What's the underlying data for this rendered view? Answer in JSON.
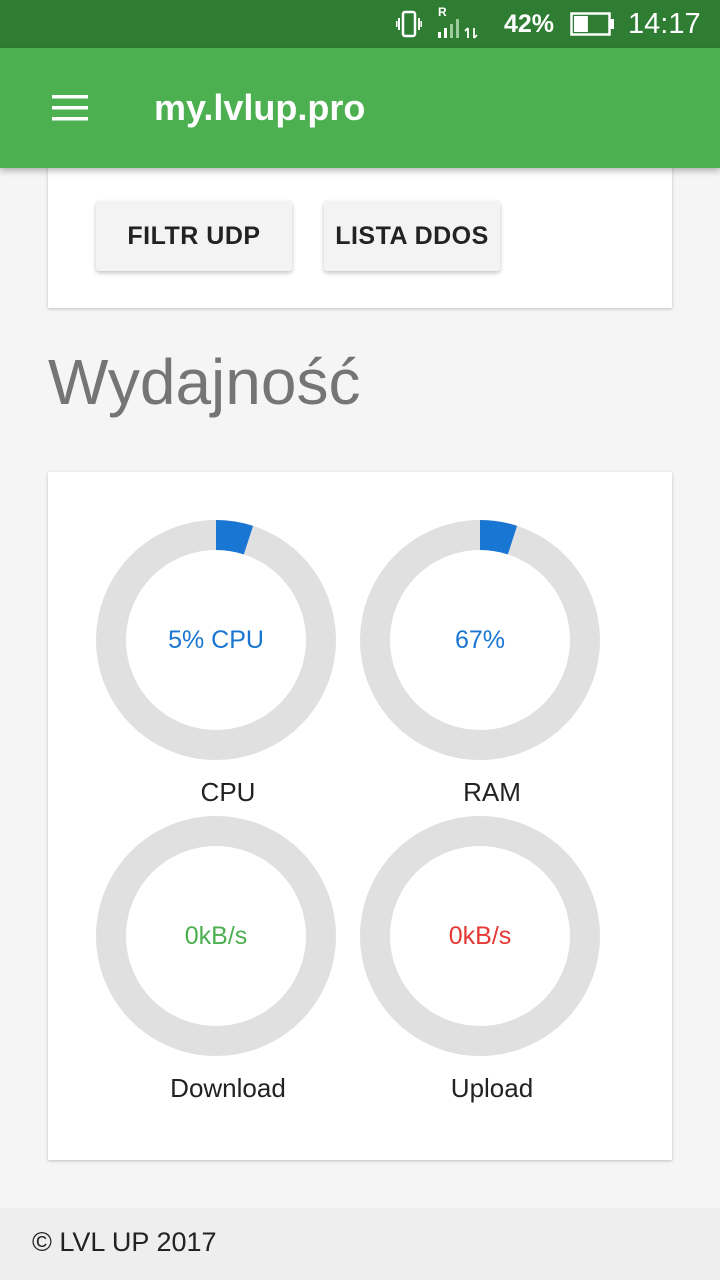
{
  "status_bar": {
    "vibrate_icon": "vibrate-icon",
    "roaming_badge": "R",
    "signal_icon": "signal-icon",
    "data_icon": "data-transfer-icon",
    "battery_percent": "42%",
    "battery_icon": "battery-icon",
    "battery_level": 0.42,
    "time": "14:17"
  },
  "app_bar": {
    "menu_icon": "menu-icon",
    "title": "my.lvlup.pro",
    "color": "#4caf50"
  },
  "top_card": {
    "buttons": [
      {
        "label": "FILTR UDP"
      },
      {
        "label": "LISTA DDOS"
      }
    ]
  },
  "performance": {
    "title": "Wydajność",
    "gauges": [
      {
        "label": "CPU",
        "value_text": "5% CPU",
        "arc_fraction": 0.05,
        "color": "#1976d2"
      },
      {
        "label": "RAM",
        "value_text": "67%",
        "arc_fraction": 0.05,
        "color": "#1976d2"
      },
      {
        "label": "Download",
        "value_text": "0kB/s",
        "arc_fraction": 0,
        "color": "#4caf50"
      },
      {
        "label": "Upload",
        "value_text": "0kB/s",
        "arc_fraction": 0,
        "color": "#e53935"
      }
    ],
    "track_color": "#e0e0e0"
  },
  "footer": {
    "text": "© LVL UP 2017"
  }
}
